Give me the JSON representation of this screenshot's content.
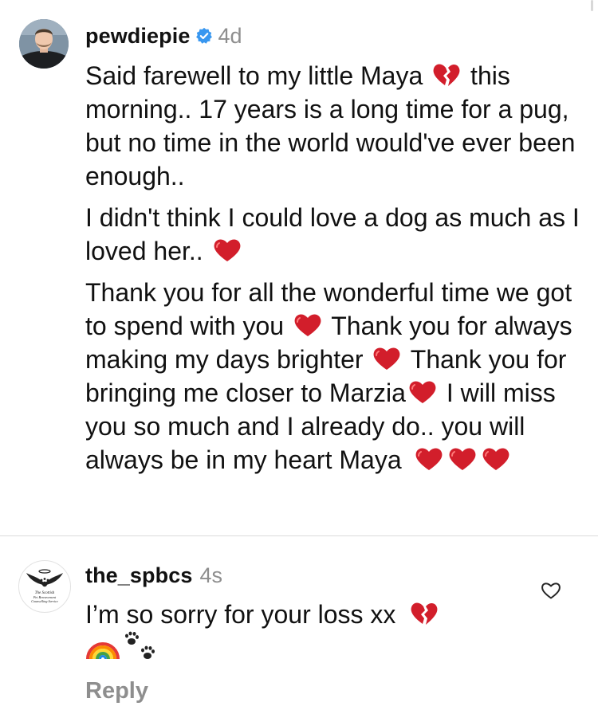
{
  "post": {
    "username": "pewdiepie",
    "verified": true,
    "timestamp": "4d",
    "paragraphs": {
      "p1_a": "Said farewell to my little Maya",
      "p1_b": "this morning.. 17 years is a long time for a pug, but no time in the world would've ever been enough..",
      "p2_a": "I didn't think I could love a dog as much as I loved her..",
      "p3_a": "Thank you for all the wonderful time we got to spend with you",
      "p3_b": "Thank you for always making my days brighter",
      "p3_c": "Thank you for bringing me closer to Marzia",
      "p3_d": "I will miss you so much and I already do.. you will always be in my heart Maya"
    },
    "icons": {
      "avatar": "avatar-photo",
      "verified": "verified-badge-icon",
      "broken_heart": "broken-heart-emoji",
      "heart": "red-heart-emoji"
    }
  },
  "reply": {
    "username": "the_spbcs",
    "timestamp": "4s",
    "text": "I’m so sorry for your loss xx",
    "action_label": "Reply",
    "avatar_logo_lines": [
      "The Scottish",
      "Pet Bereavement",
      "Counselling Service"
    ],
    "icons": {
      "like": "heart-outline-icon",
      "emojis": [
        "rainbow-emoji",
        "paw-prints-emoji"
      ]
    }
  },
  "colors": {
    "text": "#111111",
    "muted": "#8e8e8e",
    "verified": "#3897f0",
    "heart_red": "#d21e2b",
    "divider": "#dbdbdb"
  }
}
